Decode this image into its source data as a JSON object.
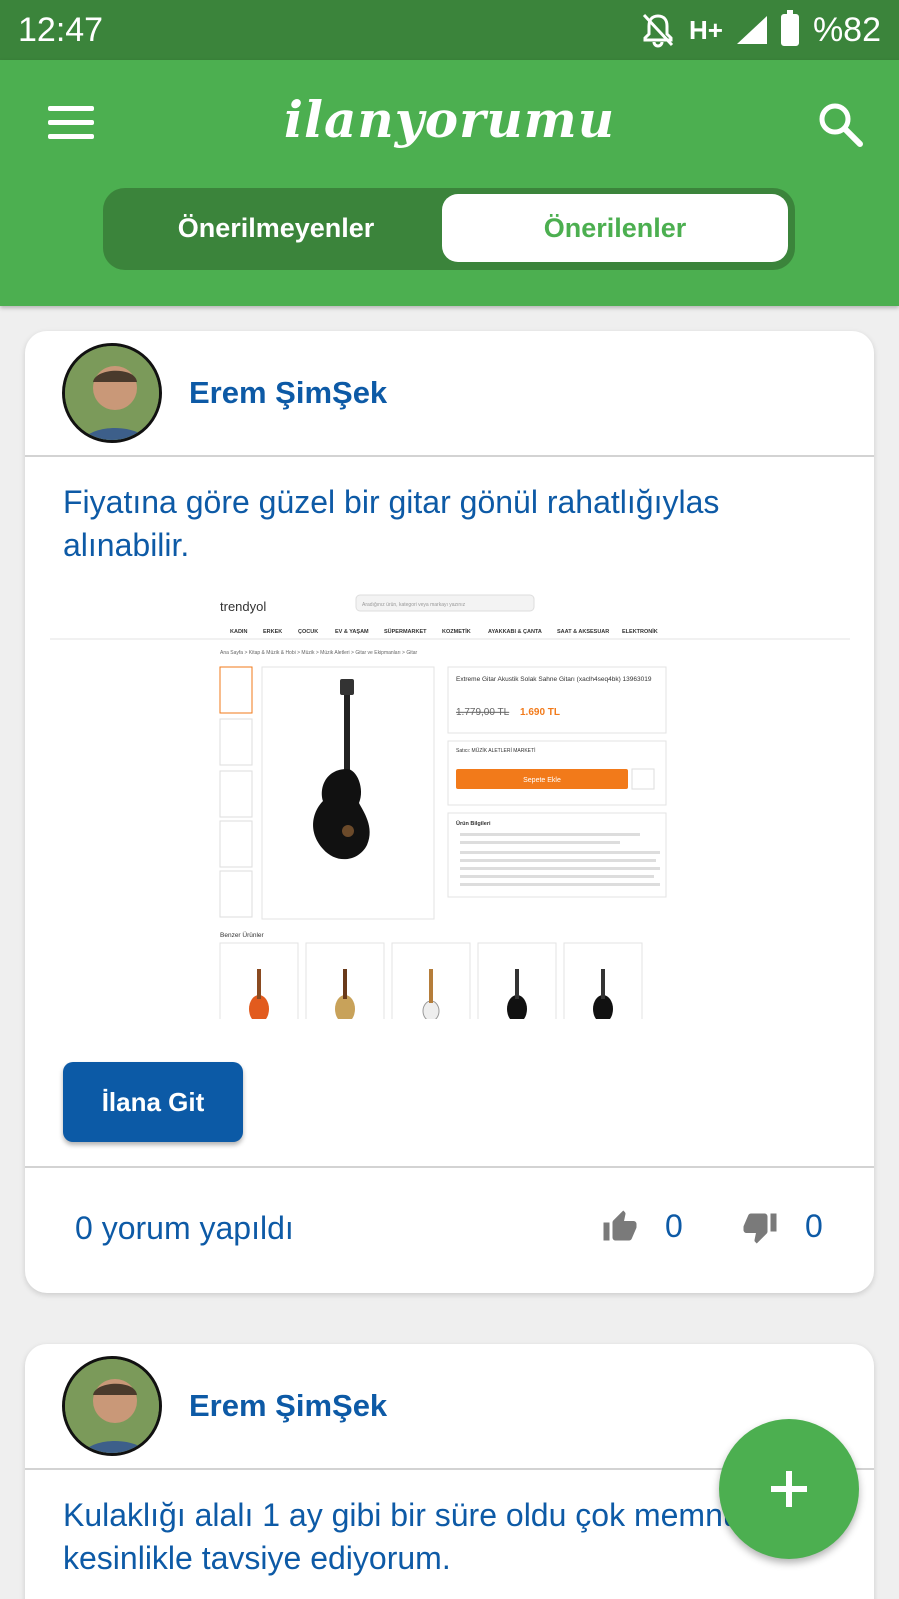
{
  "status_bar": {
    "time": "12:47",
    "network": "H+",
    "battery": "%82",
    "icons": [
      "mute-icon",
      "signal-icon",
      "battery-icon"
    ]
  },
  "app_bar": {
    "logo": "ilanyorumu",
    "tabs": {
      "not_recommended": "Önerilmeyenler",
      "recommended": "Önerilenler",
      "active": "recommended"
    },
    "colors": {
      "primary": "#4caf50",
      "dark": "#3b843b",
      "text_blue": "#0d5aa6"
    }
  },
  "posts": [
    {
      "author": "Erem ŞimŞek",
      "text": "Fiyatına göre güzel bir gitar gönül rahatlığıylas alınabilir.",
      "button_label": "İlana Git",
      "comment_count_label": "0 yorum yapıldı",
      "likes": "0",
      "dislikes": "0",
      "embedded_listing": {
        "brand": "trendyol",
        "search_placeholder": "Aradığınız ürün, kategori veya markayı yazınız",
        "categories": [
          "KADIN",
          "ERKEK",
          "ÇOCUK",
          "EV & YAŞAM",
          "SÜPERMARKET",
          "KOZMETİK",
          "AYAKKABI & ÇANTA",
          "SAAT & AKSESUAR",
          "ELEKTRONİK"
        ],
        "breadcrumb": "Ana Sayfa > Kitap & Müzik & Hobi > Müzik > Müzik Aletleri > Gitar ve Ekipmanları > Gitar",
        "product_title": "Extreme Gitar Akustik Solak Sahne Gitarı (xaclh4seq4bk) 13963019",
        "old_price": "1.779,00 TL",
        "price": "1.690 TL",
        "seller": "Satıcı: MÜZİK ALETLERİ MARKETİ",
        "add_to_cart": "Sepete Ekle",
        "info_title": "Ürün Bilgileri",
        "similar_title": "Benzer Ürünler"
      }
    },
    {
      "author": "Erem ŞimŞek",
      "text": "Kulaklığı alalı 1 ay gibi bir süre oldu çok memnunum kesinlikle tavsiye ediyorum."
    }
  ],
  "fab": {
    "icon": "plus-icon"
  }
}
